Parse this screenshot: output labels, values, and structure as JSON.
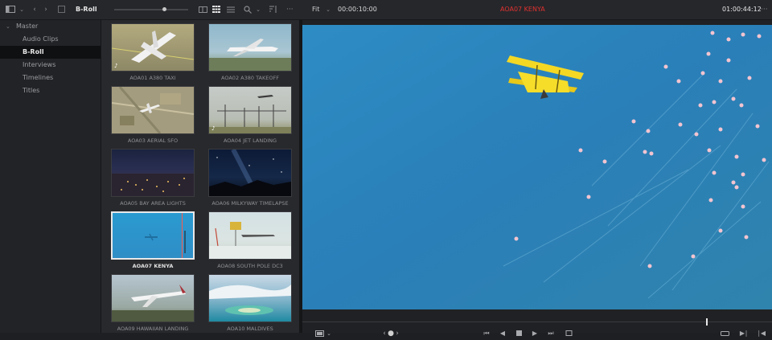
{
  "toolbar": {
    "bin_name": "B-Roll",
    "fit_label": "Fit",
    "source_timecode": "00:00:10:00",
    "clip_title": "AOA07 KENYA",
    "record_timecode": "01:00:44:12",
    "more_label": "···"
  },
  "sidebar": {
    "root_label": "Master",
    "items": [
      {
        "label": "Audio Clips"
      },
      {
        "label": "B-Roll"
      },
      {
        "label": "Interviews"
      },
      {
        "label": "Timelines"
      },
      {
        "label": "Titles"
      }
    ]
  },
  "media_pool": {
    "clips": [
      {
        "name": "AOA01 A380 TAXI"
      },
      {
        "name": "AOA02 A380 TAKEOFF"
      },
      {
        "name": "AOA03 AERIAL SFO"
      },
      {
        "name": "AOA04 JET LANDING"
      },
      {
        "name": "AOA05 BAY AREA LIGHTS"
      },
      {
        "name": "AOA06 MILKYWAY TIMELAPSE"
      },
      {
        "name": "AOA07 KENYA"
      },
      {
        "name": "AOA08 SOUTH POLE DC3"
      },
      {
        "name": "AOA09 HAWAIIAN LANDING"
      },
      {
        "name": "AOA10 MALDIVES"
      }
    ],
    "selected_index": 6
  },
  "viewer": {
    "playhead_fraction": 0.86
  },
  "icons": {
    "panel_toggle": "panel-toggle-icon",
    "search": "search-icon",
    "sort": "sort-icon",
    "play": "play-icon",
    "loop": "loop-icon"
  },
  "colors": {
    "title_red": "#e0322f",
    "selection_white": "#e8e8e8"
  }
}
